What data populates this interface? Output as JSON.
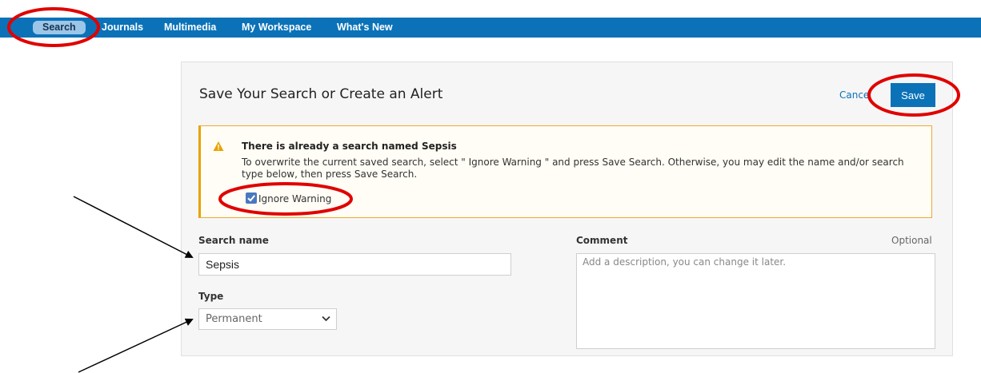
{
  "nav": {
    "items": [
      {
        "label": "Search",
        "active": true
      },
      {
        "label": "Journals",
        "active": false
      },
      {
        "label": "Multimedia",
        "active": false
      },
      {
        "label": "My Workspace",
        "active": false
      },
      {
        "label": "What's New",
        "active": false
      }
    ]
  },
  "dialog": {
    "title": "Save Your Search or Create an Alert",
    "cancel_label": "Cance",
    "save_label": "Save"
  },
  "warning": {
    "title": "There is already a search named Sepsis",
    "body": "To overwrite the current saved search, select \" Ignore Warning \" and press Save Search. Otherwise, you may edit the name and/or search type below, then press Save Search.",
    "checkbox_label": "Ignore Warning",
    "checkbox_checked": true
  },
  "form": {
    "search_name_label": "Search name",
    "search_name_value": "Sepsis",
    "type_label": "Type",
    "type_value": "Permanent",
    "comment_label": "Comment",
    "comment_optional": "Optional",
    "comment_placeholder": "Add a description, you can change it later."
  },
  "colors": {
    "nav_bg": "#0b72b8",
    "accent": "#0b72b8",
    "warning_border": "#e8a200",
    "annotation_red": "#e00000"
  }
}
